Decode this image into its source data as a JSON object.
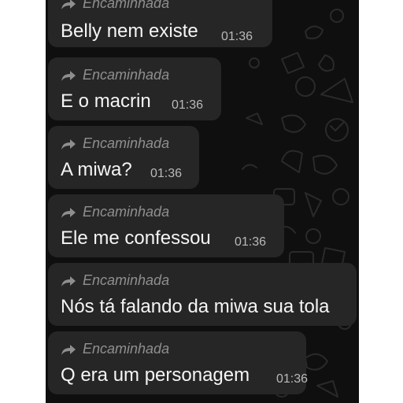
{
  "messages": [
    {
      "forwarded_label": "Encaminhada",
      "text": "Belly nem existe",
      "time": "01:36"
    },
    {
      "forwarded_label": "Encaminhada",
      "text": "E o macrin",
      "time": "01:36"
    },
    {
      "forwarded_label": "Encaminhada",
      "text": "A miwa?",
      "time": "01:36"
    },
    {
      "forwarded_label": "Encaminhada",
      "text": "Ele me confessou",
      "time": "01:36"
    },
    {
      "forwarded_label": "Encaminhada",
      "text": "Nós tá falando da miwa sua tola",
      "time": ""
    },
    {
      "forwarded_label": "Encaminhada",
      "text": "Q era um personagem",
      "time": "01:36"
    }
  ],
  "colors": {
    "chat_background": "#0f0f0f",
    "bubble": "#262626",
    "meta_text": "#8f8f8f"
  },
  "icons": {
    "forward": "forward-arrow-icon",
    "wallpaper": "doodle-wallpaper"
  }
}
